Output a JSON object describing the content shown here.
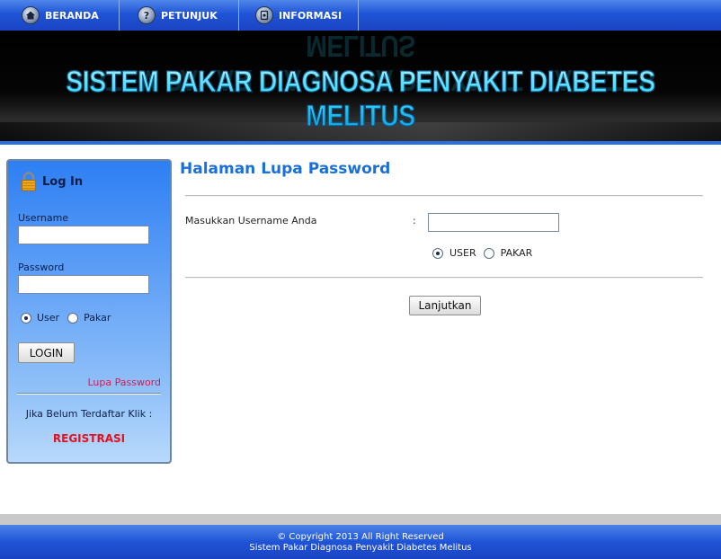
{
  "nav": {
    "items": [
      {
        "label": "BERANDA",
        "icon": "home-icon"
      },
      {
        "label": "PETUNJUK",
        "icon": "help-icon"
      },
      {
        "label": "INFORMASI",
        "icon": "info-icon"
      }
    ]
  },
  "banner": {
    "title": "SISTEM PAKAR DIAGNOSA PENYAKIT DIABETES MELITUS"
  },
  "login": {
    "title": "Log In",
    "username_label": "Username",
    "password_label": "Password",
    "username_value": "",
    "password_value": "",
    "role_options": [
      "User",
      "Pakar"
    ],
    "selected_role": "User",
    "login_button": "LOGIN",
    "forgot_link": "Lupa Password",
    "register_notice": "Jika Belum Terdaftar Klik :",
    "register_link": "REGISTRASI"
  },
  "main": {
    "title": "Halaman Lupa Password",
    "field_label": "Masukkan Username Anda",
    "colon": ":",
    "username_value": "",
    "role_options": [
      "USER",
      "PAKAR"
    ],
    "selected_role": "USER",
    "submit_button": "Lanjutkan"
  },
  "footer": {
    "copyright": "© Copyright 2013 All Right Reserved",
    "subtitle": "Sistem Pakar Diagnosa Penyakit Diabetes Melitus"
  },
  "colors": {
    "nav_blue": "#1f54d6",
    "banner_text": "#2fd7ff",
    "title_blue": "#1a6fd8",
    "link_red": "#e3154d",
    "register_red": "#e31020"
  }
}
